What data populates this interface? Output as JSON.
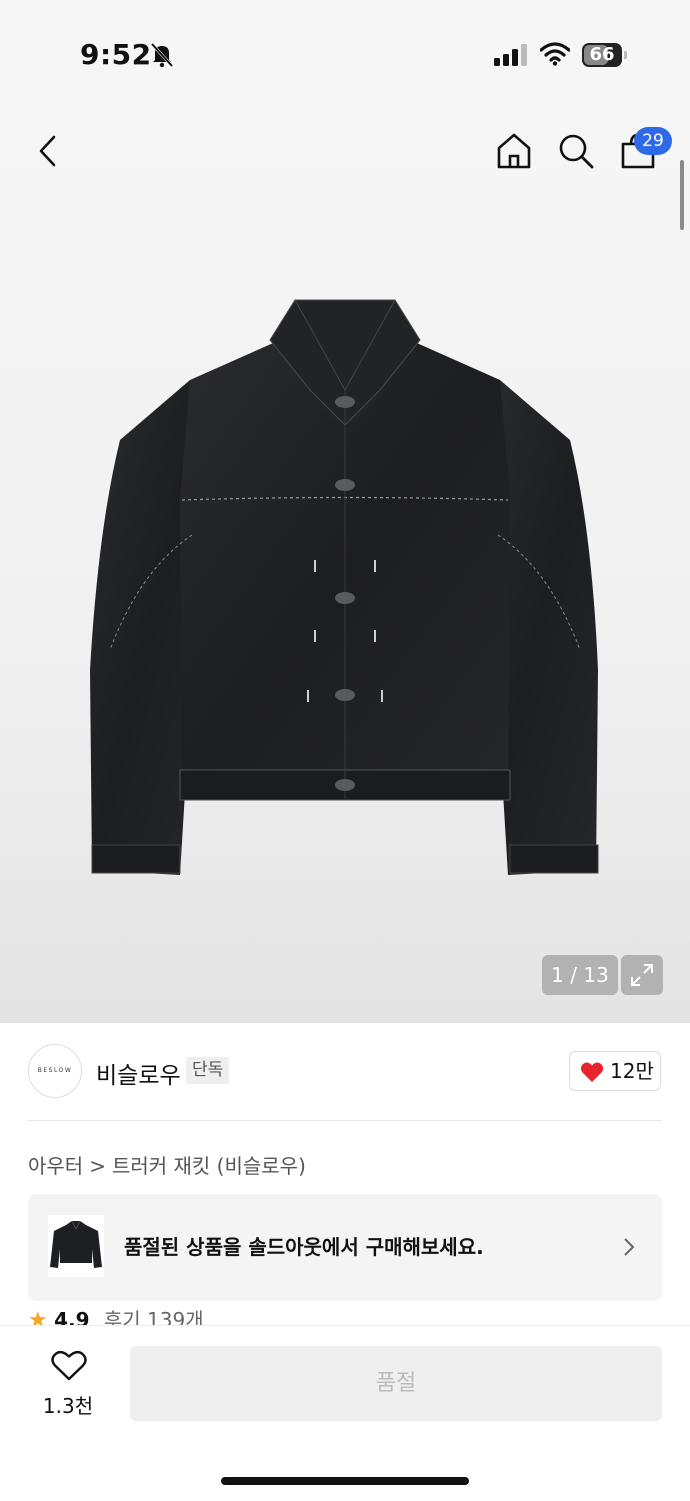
{
  "status_bar": {
    "time": "9:52",
    "battery": "66",
    "battery_level": 0.66
  },
  "header": {
    "cart_count": "29"
  },
  "gallery": {
    "counter": "1 / 13"
  },
  "brand": {
    "logo_text": "BESLOW",
    "name": "비슬로우",
    "exclusive_label": "단독",
    "like_count": "12만"
  },
  "breadcrumb": {
    "category": "아우터",
    "separator": ">",
    "product": "트러커 재킷 (비슬로우)"
  },
  "soldout_banner": {
    "text": "품절된 상품을 솔드아웃에서 구매해보세요."
  },
  "rating": {
    "star": "★",
    "score": "4.9",
    "review_label": "후기 139개"
  },
  "bottom_bar": {
    "wish_count": "1.3천",
    "buy_button_label": "품절"
  },
  "colors": {
    "accent_badge": "#2f6ae6",
    "heart": "#e8232f",
    "star": "#f5a623"
  },
  "icons": [
    "bell-slash-icon",
    "signal-icon",
    "wifi-icon",
    "battery-icon",
    "back-icon",
    "home-icon",
    "search-icon",
    "shopping-bag-icon",
    "expand-icon",
    "heart-icon",
    "chevron-right-icon",
    "star-icon"
  ]
}
